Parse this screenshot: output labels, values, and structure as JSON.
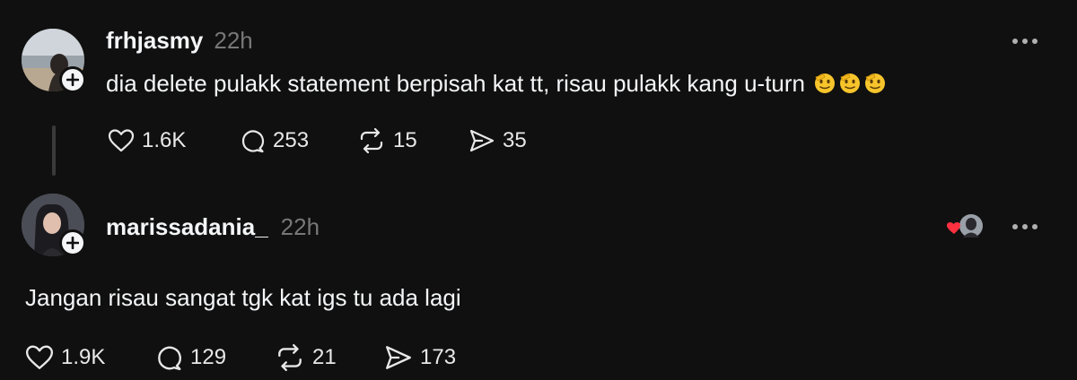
{
  "posts": [
    {
      "username": "frhjasmy",
      "time": "22h",
      "text": "dia delete pulakk statement berpisah kat tt, risau pulakk kang u-turn",
      "emoji_icon": "saluting-face-emoji",
      "emoji_count": 3,
      "likes": "1.6K",
      "replies": "253",
      "reposts": "15",
      "shares": "35"
    },
    {
      "username": "marissadania_",
      "time": "22h",
      "text": "Jangan risau sangat tgk kat igs tu ada lagi",
      "liked_by_icon": "liked-by-author-avatar",
      "likes": "1.9K",
      "replies": "129",
      "reposts": "21",
      "shares": "173"
    }
  ],
  "colors": {
    "background": "#101010",
    "text": "#f3f5f7",
    "muted": "#777777",
    "heart_red": "#ff3040"
  }
}
